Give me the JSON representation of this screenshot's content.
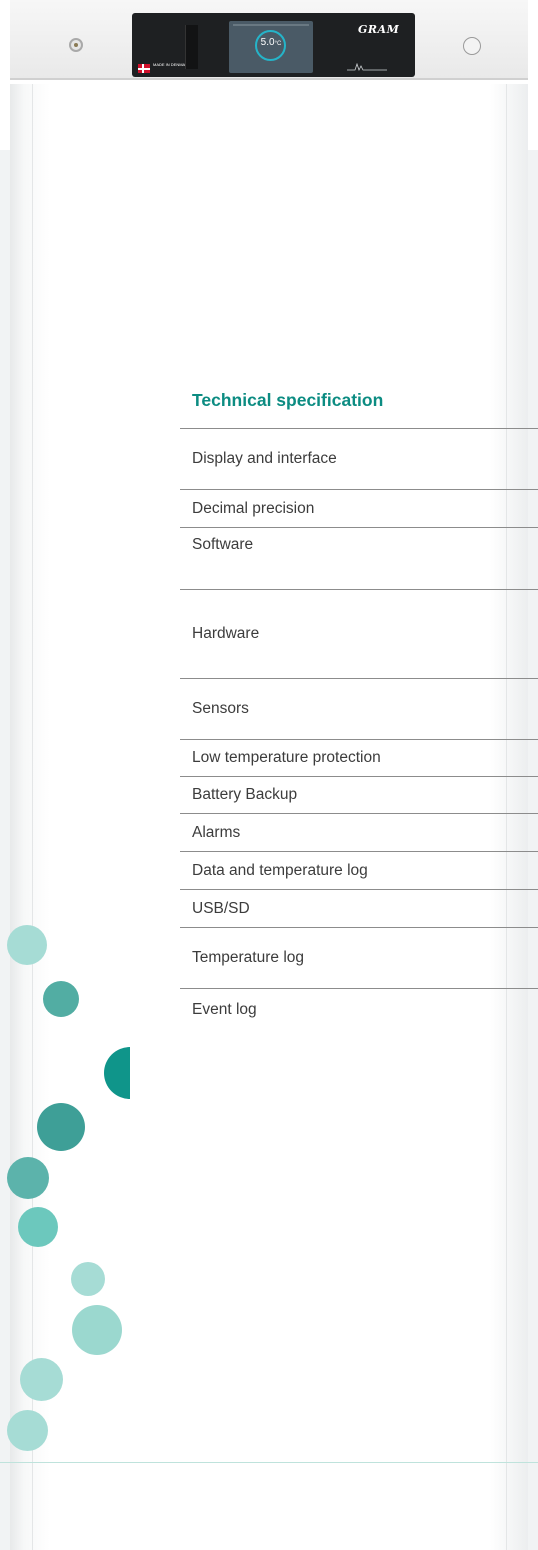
{
  "product": {
    "brand_logo": "GRAM",
    "origin_badge": "MADE IN DENMARK",
    "display_temperature": "5.0",
    "display_unit": "°C"
  },
  "specification": {
    "title": "Technical specification",
    "rows": [
      {
        "label": "Display and interface"
      },
      {
        "label": "Decimal precision"
      },
      {
        "label": "Software"
      },
      {
        "label": "Hardware"
      },
      {
        "label": "Sensors"
      },
      {
        "label": "Low temperature protection"
      },
      {
        "label": "Battery Backup"
      },
      {
        "label": "Alarms"
      },
      {
        "label": "Data and temperature log"
      },
      {
        "label": "USB/SD"
      },
      {
        "label": "Temperature log"
      },
      {
        "label": "Event log"
      }
    ]
  },
  "colors": {
    "accent": "#0c8c82",
    "divider": "#8c8c8c",
    "circle_teal": "#0f958a",
    "circle_mid": "#5cb8ad",
    "circle_light": "#a6dcd5"
  }
}
